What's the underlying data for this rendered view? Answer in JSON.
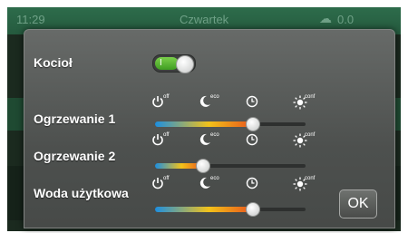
{
  "statusbar": {
    "time": "11:29",
    "day": "Czwartek",
    "weather_icon": "cloud-sun-icon",
    "temperature": "0.0"
  },
  "background": {
    "digit": "0"
  },
  "dialog": {
    "boiler": {
      "label": "Kocioł",
      "toggle_text": "I",
      "state": "on"
    },
    "mode_icons": [
      {
        "name": "off",
        "icon": "power-icon",
        "superscript": "off"
      },
      {
        "name": "eco",
        "icon": "moon-icon",
        "superscript": "eco"
      },
      {
        "name": "auto",
        "icon": "clock-icon",
        "superscript": ""
      },
      {
        "name": "comfort",
        "icon": "sun-icon",
        "superscript": "conf"
      }
    ],
    "rows": [
      {
        "label": "Ogrzewanie 1",
        "slider_level_percent": 65
      },
      {
        "label": "Ogrzewanie 2",
        "slider_level_percent": 32
      },
      {
        "label": "Woda użytkowa",
        "slider_level_percent": 65
      }
    ],
    "ok_label": "OK"
  },
  "colors": {
    "status_green": "#2d6c4b",
    "toggle_on": "#5bb636",
    "slider_cold": "#1d8fe0",
    "slider_mid": "#f2c21a",
    "slider_hot": "#e8541b"
  }
}
